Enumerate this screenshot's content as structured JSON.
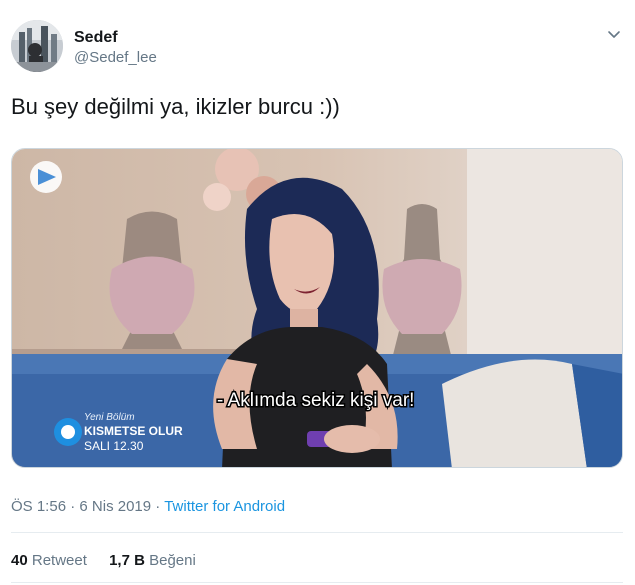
{
  "user": {
    "name": "Sedef",
    "handle": "@Sedef_lee"
  },
  "tweet": {
    "text": "Bu şey değilmi ya, ikizler burcu :))"
  },
  "media": {
    "subtitle": "- Aklımda sekiz kişi var!",
    "promo_line1": "Yeni Bölüm",
    "promo_line2": "KISMETSE OLUR",
    "promo_line3": "SALI 12.30"
  },
  "meta": {
    "time": "ÖS 1:56",
    "sep1": "·",
    "date": "6 Nis 2019",
    "sep2": "·",
    "source": "Twitter for Android"
  },
  "stats": {
    "retweet_count": "40",
    "retweet_label": "Retweet",
    "like_count": "1,7 B",
    "like_label": "Beğeni"
  },
  "icons": {
    "menu": "chevron-down-icon"
  }
}
